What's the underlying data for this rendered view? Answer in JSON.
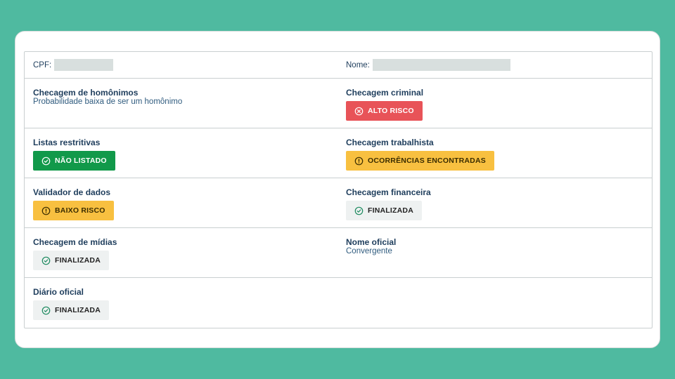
{
  "colors": {
    "background": "#4fbaa0",
    "label": "#1e3d5c",
    "danger": "#e85358",
    "success": "#11994a",
    "warning": "#f8c040",
    "neutral": "#eef1f1",
    "check_green": "#1d8a5f"
  },
  "header": {
    "cpf_label": "CPF:",
    "nome_label": "Nome:"
  },
  "checks": {
    "homonimos": {
      "label": "Checagem de homônimos",
      "text": "Probabilidade baixa de ser um homônimo"
    },
    "criminal": {
      "label": "Checagem criminal",
      "status": "ALTO RISCO",
      "icon": "x-circle-icon"
    },
    "listas": {
      "label": "Listas restritivas",
      "status": "NÃO LISTADO",
      "icon": "check-circle-icon"
    },
    "trabalhista": {
      "label": "Checagem trabalhista",
      "status": "OCORRÊNCIAS ENCONTRADAS",
      "icon": "alert-circle-icon"
    },
    "validador": {
      "label": "Validador de dados",
      "status": "BAIXO RISCO",
      "icon": "alert-circle-icon"
    },
    "financeira": {
      "label": "Checagem financeira",
      "status": "FINALIZADA",
      "icon": "check-circle-icon"
    },
    "midias": {
      "label": "Checagem de mídias",
      "status": "FINALIZADA",
      "icon": "check-circle-icon"
    },
    "nome_oficial": {
      "label": "Nome oficial",
      "text": "Convergente"
    },
    "diario": {
      "label": "Diário oficial",
      "status": "FINALIZADA",
      "icon": "check-circle-icon"
    }
  }
}
